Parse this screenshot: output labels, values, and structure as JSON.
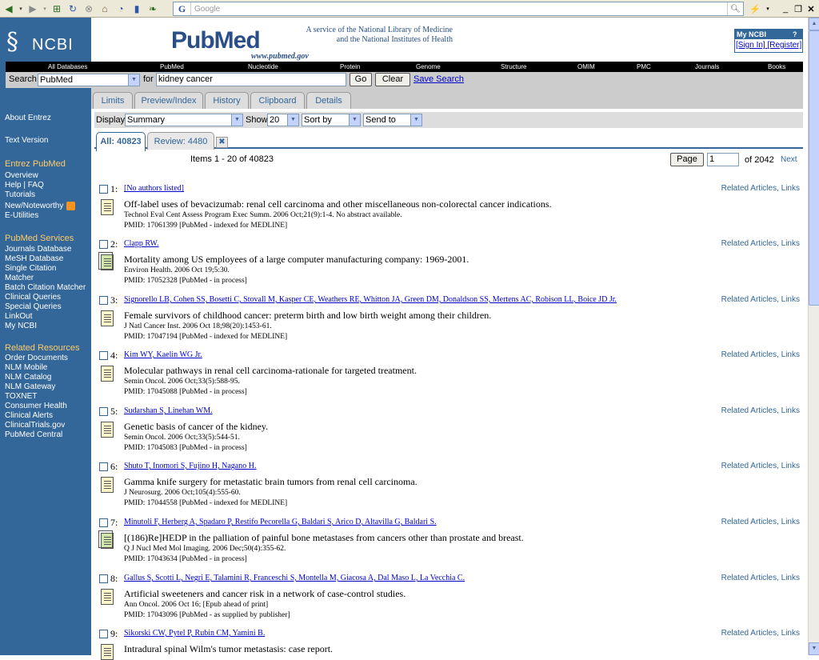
{
  "browser": {
    "google_placeholder": "Google",
    "google_logo": "G"
  },
  "header": {
    "ncbi_label": "NCBI",
    "pubmed_logo": "PubMed",
    "pubmed_url": "www.pubmed.gov",
    "service_line1": "A service of the National Library of Medicine",
    "service_line2": "and the National Institutes of Health",
    "myncbi_title": "My NCBI",
    "myncbi_help": "?",
    "sign_in": "[Sign In]",
    "register": "[Register]"
  },
  "databases": [
    "All Databases",
    "PubMed",
    "Nucleotide",
    "Protein",
    "Genome",
    "Structure",
    "OMIM",
    "PMC",
    "Journals",
    "Books"
  ],
  "search": {
    "label": "Search",
    "db_value": "PubMed",
    "for_label": "for",
    "query": "kidney cancer",
    "go": "Go",
    "clear": "Clear",
    "save": "Save Search"
  },
  "tabs": [
    "Limits",
    "Preview/Index",
    "History",
    "Clipboard",
    "Details"
  ],
  "display": {
    "display_label": "Display",
    "display_value": "Summary",
    "show_label": "Show",
    "show_value": "20",
    "sort_value": "Sort by",
    "send_value": "Send to"
  },
  "result_tabs": {
    "all": "All: 40823",
    "review": "Review: 4480"
  },
  "pager": {
    "items": "Items 1 - 20 of 40823",
    "page_button": "Page",
    "page_value": "1",
    "of_text": "of 2042",
    "next": "Next"
  },
  "sidebar": {
    "links_top": [
      "About Entrez",
      "Text Version"
    ],
    "entrez_head": "Entrez PubMed",
    "entrez_links": [
      "Overview",
      "Help | FAQ",
      "Tutorials",
      "New/Noteworthy",
      "E-Utilities"
    ],
    "services_head": "PubMed Services",
    "services_links": [
      "Journals Database",
      "MeSH Database",
      "Single Citation",
      "Matcher",
      "Batch Citation Matcher",
      "Clinical Queries",
      "Special Queries",
      "LinkOut",
      "My NCBI"
    ],
    "resources_head": "Related Resources",
    "resources_links": [
      "Order Documents",
      "NLM Mobile",
      "NLM Catalog",
      "NLM Gateway",
      "TOXNET",
      "Consumer Health",
      "Clinical Alerts",
      "ClinicalTrials.gov",
      "PubMed Central"
    ]
  },
  "related_label": "Related Articles, Links",
  "results": [
    {
      "num": "1:",
      "authors": "[No authors listed]",
      "title": "Off-label uses of bevacizumab: renal cell carcinoma and other miscellaneous non-colorectal cancer indications.",
      "source": "Technol Eval Cent Assess Program Exec Summ. 2006 Oct;21(9):1-4. No abstract available.",
      "pmid": "PMID: 17061399 [PubMed - indexed for MEDLINE]",
      "full": false
    },
    {
      "num": "2:",
      "authors": "Clapp RW.",
      "title": "Mortality among US employees of a large computer manufacturing company: 1969-2001.",
      "source": "Environ Health. 2006 Oct 19;5:30.",
      "pmid": "PMID: 17052328 [PubMed - in process]",
      "full": true
    },
    {
      "num": "3:",
      "authors": "Signorello LB, Cohen SS, Bosetti C, Stovall M, Kasper CE, Weathers RE, Whitton JA, Green DM, Donaldson SS, Mertens AC, Robison LL, Boice JD Jr.",
      "title": "Female survivors of childhood cancer: preterm birth and low birth weight among their children.",
      "source": "J Natl Cancer Inst. 2006 Oct 18;98(20):1453-61.",
      "pmid": "PMID: 17047194 [PubMed - indexed for MEDLINE]",
      "full": false
    },
    {
      "num": "4:",
      "authors": "Kim WY, Kaelin WG Jr.",
      "title": "Molecular pathways in renal cell carcinoma-rationale for targeted treatment.",
      "source": "Semin Oncol. 2006 Oct;33(5):588-95.",
      "pmid": "PMID: 17045088 [PubMed - in process]",
      "full": false
    },
    {
      "num": "5:",
      "authors": "Sudarshan S, Linehan WM.",
      "title": "Genetic basis of cancer of the kidney.",
      "source": "Semin Oncol. 2006 Oct;33(5):544-51.",
      "pmid": "PMID: 17045083 [PubMed - in process]",
      "full": false
    },
    {
      "num": "6:",
      "authors": "Shuto T, Inomori S, Fujino H, Nagano H.",
      "title": "Gamma knife surgery for metastatic brain tumors from renal cell carcinoma.",
      "source": "J Neurosurg. 2006 Oct;105(4):555-60.",
      "pmid": "PMID: 17044558 [PubMed - indexed for MEDLINE]",
      "full": false
    },
    {
      "num": "7:",
      "authors": "Minutoli F, Herberg A, Spadaro P, Restifo Pecorella G, Baldari S, Arico D, Altavilla G, Baldari S.",
      "title": "[(186)Re]HEDP in the palliation of painful bone metastases from cancers other than prostate and breast.",
      "source": "Q J Nucl Med Mol Imaging. 2006 Dec;50(4):355-62.",
      "pmid": "PMID: 17043634 [PubMed - in process]",
      "full": true
    },
    {
      "num": "8:",
      "authors": "Gallus S, Scotti L, Negri E, Talamini R, Franceschi S, Montella M, Giacosa A, Dal Maso L, La Vecchia C.",
      "title": "Artificial sweeteners and cancer risk in a network of case-control studies.",
      "source": "Ann Oncol. 2006 Oct 16; [Epub ahead of print]",
      "pmid": "PMID: 17043096 [PubMed - as supplied by publisher]",
      "full": false
    },
    {
      "num": "9:",
      "authors": "Sikorski CW, Pytel P, Rubin CM, Yamini B.",
      "title": "Intradural spinal Wilm's tumor metastasis: case report.",
      "source": "",
      "pmid": "",
      "full": false
    }
  ]
}
